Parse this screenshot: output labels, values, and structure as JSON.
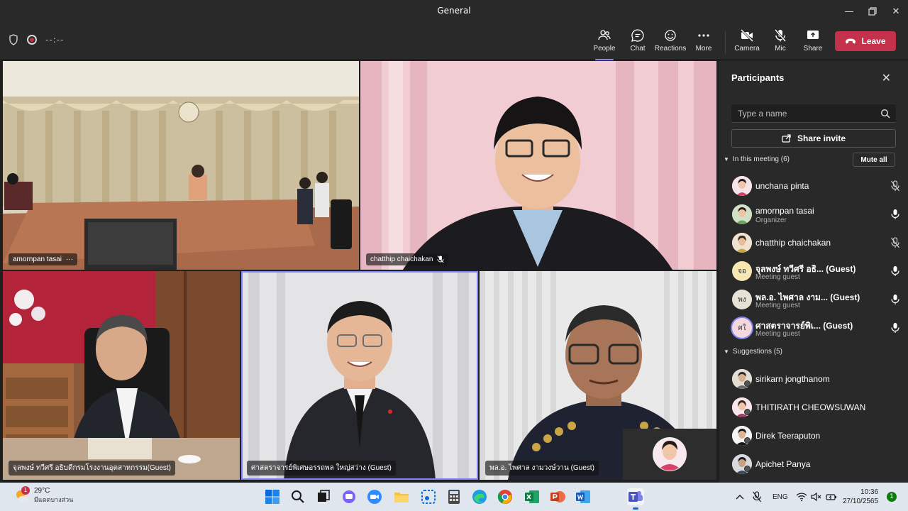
{
  "window": {
    "title": "General"
  },
  "toolbar": {
    "timer": "--:--",
    "buttons": {
      "people": "People",
      "chat": "Chat",
      "reactions": "Reactions",
      "more": "More",
      "camera": "Camera",
      "mic": "Mic",
      "share": "Share"
    },
    "leave_label": "Leave"
  },
  "videos": [
    {
      "name": "amornpan tasai"
    },
    {
      "name": "chatthip chaichakan"
    },
    {
      "name": "จุลพงษ์ ทวีศรี อธิบดีกรมโรงงานอุตสาหกรรม(Guest)"
    },
    {
      "name": "ศาสตราจารย์พิเศษอรรถพล ใหญ่สว่าง (Guest)"
    },
    {
      "name": "พล.อ. ไพศาล งามวงษ์วาน (Guest)"
    }
  ],
  "panel": {
    "title": "Participants",
    "search_placeholder": "Type a name",
    "share_invite": "Share invite",
    "in_meeting_label": "In this meeting (6)",
    "mute_all": "Mute all",
    "suggestions_label": "Suggestions (5)",
    "participants": [
      {
        "name": "unchana pinta",
        "sub": "",
        "mic": "muted"
      },
      {
        "name": "amornpan tasai",
        "sub": "Organizer",
        "mic": "on"
      },
      {
        "name": "chatthip chaichakan",
        "sub": "",
        "mic": "muted"
      },
      {
        "name": "จุลพงษ์ ทวีศรี อธิ... (Guest)",
        "sub": "Meeting guest",
        "initials": "จอ",
        "mic": "on"
      },
      {
        "name": "พล.อ. ไพศาล งาม... (Guest)",
        "sub": "Meeting guest",
        "initials": "พง",
        "mic": "on"
      },
      {
        "name": "ศาสตราจารย์พิเ... (Guest)",
        "sub": "Meeting guest",
        "initials": "ศใ",
        "mic": "on"
      }
    ],
    "suggestions": [
      {
        "name": "sirikarn jongthanom"
      },
      {
        "name": "THITIRATH CHEOWSUWAN"
      },
      {
        "name": "Direk Teeraputon"
      },
      {
        "name": "Apichet Panya"
      }
    ]
  },
  "taskbar": {
    "weather_temp": "29°C",
    "weather_desc": "มีแดดบางส่วน",
    "weather_badge": "1",
    "lang": "ENG",
    "time": "10:36",
    "date": "27/10/2565",
    "notifications": "1"
  }
}
